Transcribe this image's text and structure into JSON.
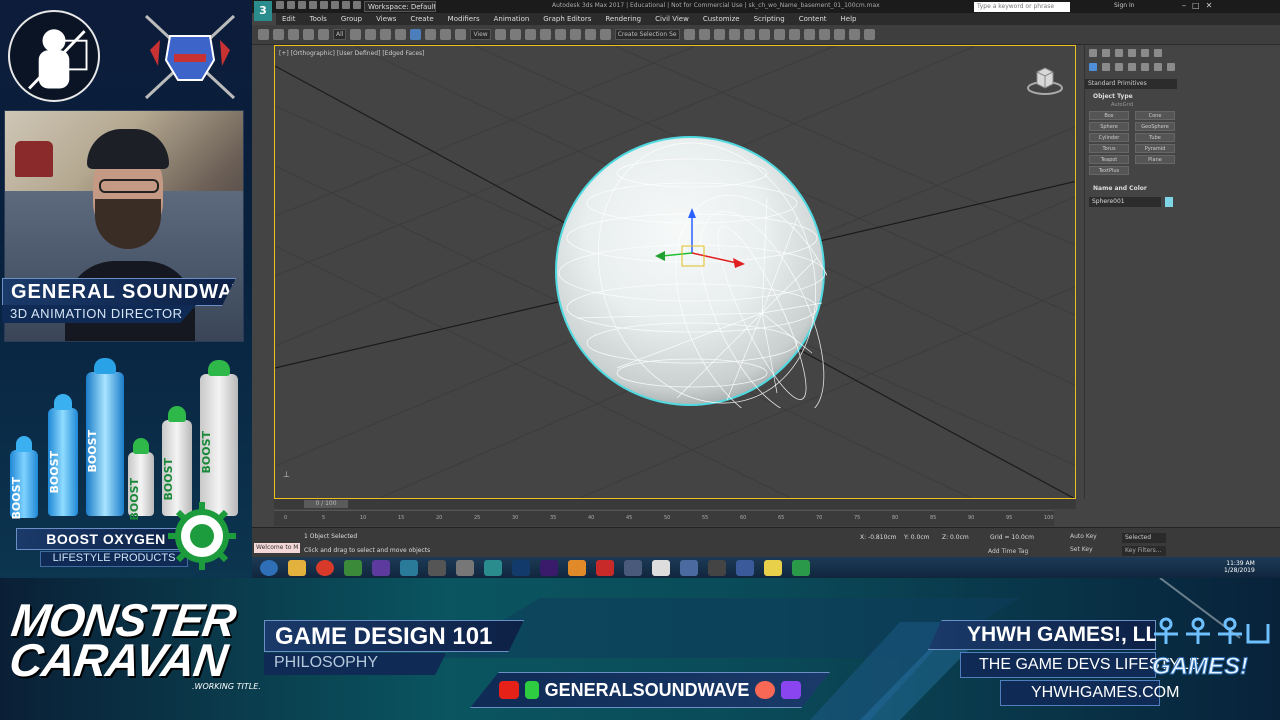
{
  "presenter": {
    "name": "GENERAL SOUNDWAVE",
    "role": "3D ANIMATION DIRECTOR"
  },
  "sponsor": {
    "name": "BOOST OXYGEN",
    "tagline": "LIFESTYLE PRODUCTS",
    "can_label": "BOOST"
  },
  "app": {
    "logo_text": "3",
    "title": "Autodesk 3ds Max 2017 | Educational | Not for Commercial Use | sk_ch_wo_Name_basement_01_100cm.max",
    "workspace": "Workspace: Default",
    "search_placeholder": "Type a keyword or phrase",
    "signin": "Sign In",
    "menus": [
      "Edit",
      "Tools",
      "Group",
      "Views",
      "Create",
      "Modifiers",
      "Animation",
      "Graph Editors",
      "Rendering",
      "Civil View",
      "Customize",
      "Scripting",
      "Content",
      "Help"
    ],
    "toolbar_dropdowns": [
      "All",
      "View",
      "Create Selection Se"
    ],
    "viewport_label": "[+] [Orthographic] [User Defined] [Edged Faces]",
    "time_slider": "0 / 100",
    "trackbar_ticks": [
      "0",
      "5",
      "10",
      "15",
      "20",
      "25",
      "30",
      "35",
      "40",
      "45",
      "50",
      "55",
      "60",
      "65",
      "70",
      "75",
      "80",
      "85",
      "90",
      "95",
      "100"
    ],
    "command_panel": {
      "dropdown": "Standard Primitives",
      "section_object_type": "Object Type",
      "autogrid": "AutoGrid",
      "primitives": [
        "Box",
        "Cone",
        "Sphere",
        "GeoSphere",
        "Cylinder",
        "Tube",
        "Torus",
        "Pyramid",
        "Teapot",
        "Plane",
        "TextPlus"
      ],
      "section_name_color": "Name and Color",
      "object_name": "Sphere001",
      "object_color": "#7fd4e6"
    },
    "status": {
      "selected": "1 Object Selected",
      "prompt": "Click and drag to select and move objects",
      "maxscript": "Welcome to M",
      "x": "X: -0.810cm",
      "y": "Y: 0.0cm",
      "z": "Z: 0.0cm",
      "grid": "Grid = 10.0cm",
      "add_time_tag": "Add Time Tag",
      "auto_key": "Auto Key",
      "set_key": "Set Key",
      "selected_dd": "Selected",
      "key_filters": "Key Filters..."
    },
    "clock": {
      "time": "11:39 AM",
      "date": "1/28/2019"
    }
  },
  "banner": {
    "show_title_line1": "MONSTER",
    "show_title_line2": "CARAVAN",
    "working_title": ".WORKING TITLE.",
    "course": "GAME DESIGN 101",
    "topic": "PHILOSOPHY",
    "handle": "GENERALSOUNDWAVE",
    "company": "YHWH GAMES!, LLC.",
    "motto": "THE GAME DEVS LIFESTYLE",
    "url": "YHWHGAMES.COM",
    "logo_text": "GAMES!"
  },
  "colors": {
    "selection_outline": "#4fd9e0",
    "viewport_border": "#f0c020",
    "youtube": "#e62117",
    "twitch": "#8a45f0",
    "patreon": "#f96854",
    "streamlabs": "#2ecc40"
  }
}
